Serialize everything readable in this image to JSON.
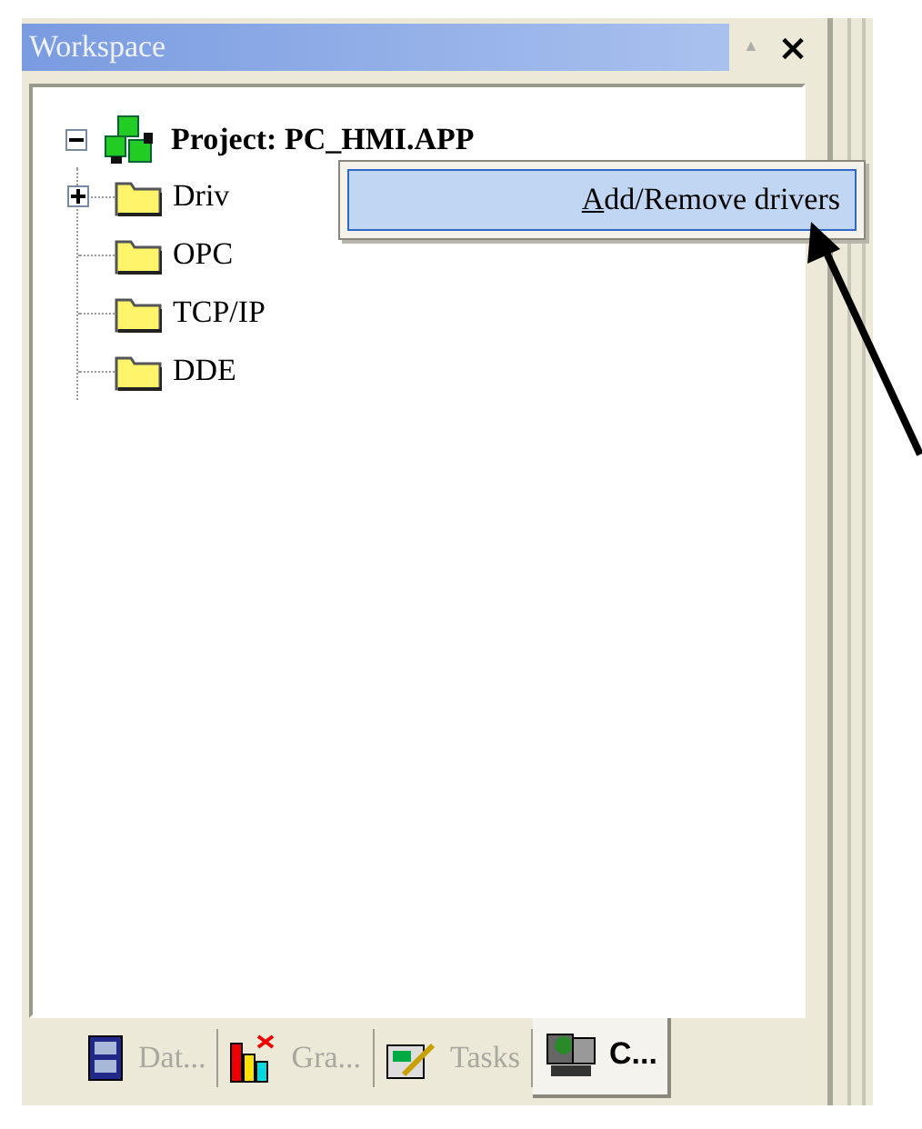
{
  "panel": {
    "title": "Workspace",
    "pin": "▲",
    "close": "×"
  },
  "tree": {
    "label": "Project: PC_HMI.APP",
    "expanded": true,
    "children": [
      {
        "label": "Driv",
        "expandable": true,
        "expanded": false
      },
      {
        "label": "OPC"
      },
      {
        "label": "TCP/IP"
      },
      {
        "label": "DDE"
      }
    ]
  },
  "context_menu": {
    "items": [
      {
        "mnemonic": "A",
        "rest": "dd/Remove drivers",
        "selected": true
      }
    ]
  },
  "tabs": [
    {
      "kind": "database",
      "label": "Dat...",
      "selected": false
    },
    {
      "kind": "graphics",
      "label": "Gra...",
      "selected": false
    },
    {
      "kind": "tasks",
      "label": "Tasks",
      "selected": false
    },
    {
      "kind": "communication",
      "label": "C...",
      "selected": true
    }
  ]
}
